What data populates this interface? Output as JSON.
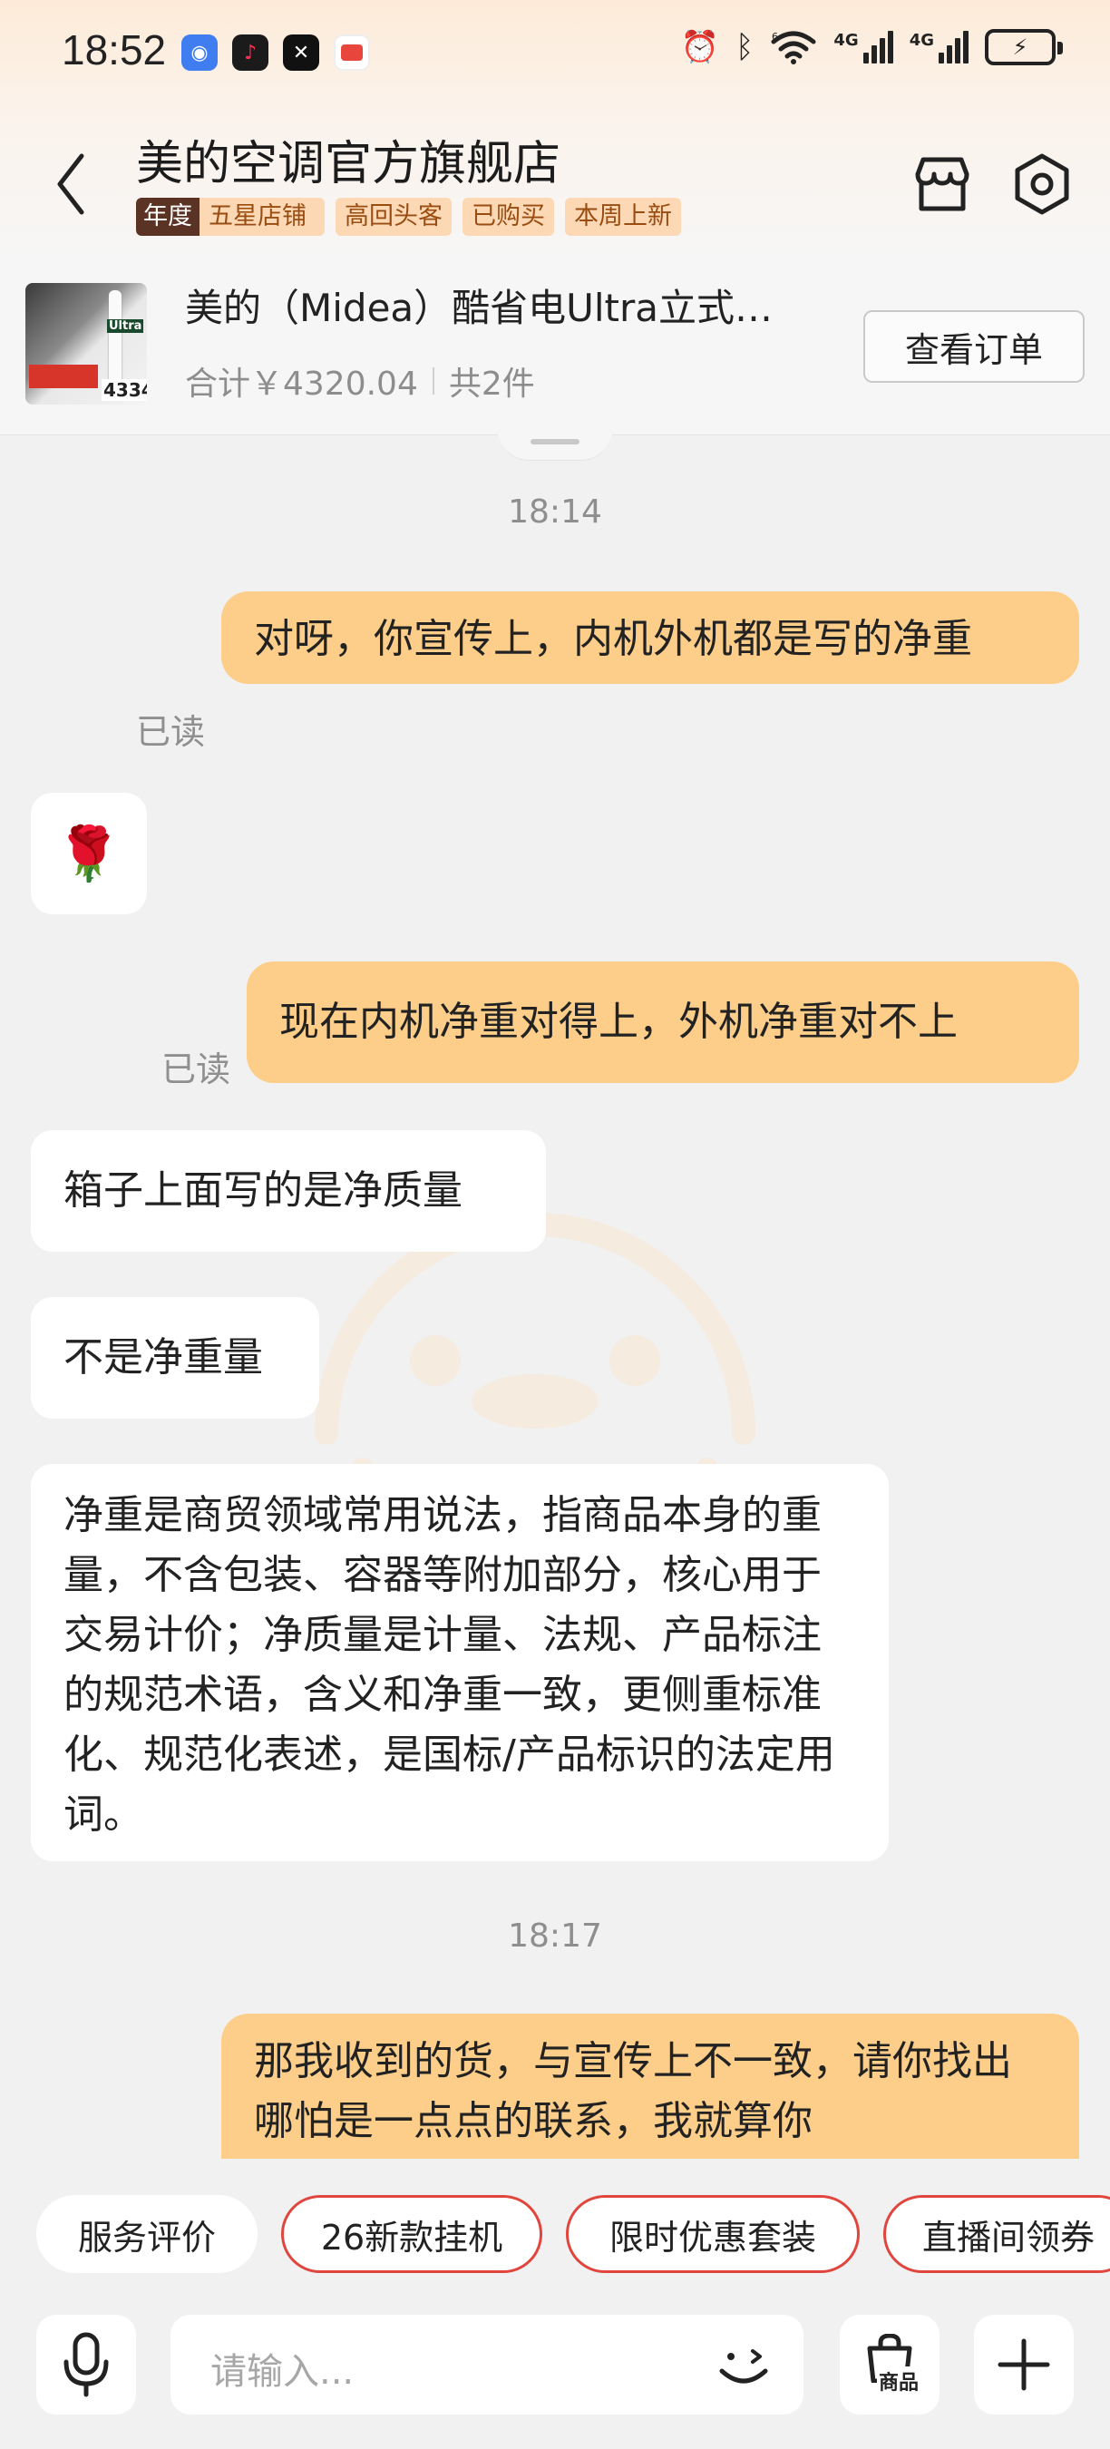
{
  "status_bar": {
    "time": "18:52",
    "apps": [
      {
        "icon": "blue-app-icon",
        "color": "#3f7df0",
        "glyph": "◉"
      },
      {
        "icon": "tiktok-icon",
        "color": "#1b1b1b",
        "glyph": "♪"
      },
      {
        "icon": "capcut-icon",
        "color": "#111111",
        "glyph": "✕"
      },
      {
        "icon": "red-app-icon",
        "color": "#e8453c",
        "glyph": "▬"
      }
    ],
    "network_label_1": "4G",
    "network_label_2": "4G",
    "wifi_label": "6"
  },
  "header": {
    "shop_name": "美的空调官方旗舰店",
    "tags": {
      "year_badge": "年度",
      "five_star": "五星店铺",
      "repeat": "高回头客",
      "bought": "已购买",
      "new_week": "本周上新"
    }
  },
  "order": {
    "product_title": "美的（Midea）酷省电Ultra立式…",
    "total": "合计￥4320.04",
    "count": "共2件",
    "view_order_label": "查看订单",
    "thumb_price": "4334",
    "thumb_badge": "Ultra"
  },
  "chat": {
    "time_1": "18:14",
    "msg_1": "对呀，你宣传上，内机外机都是写的净重",
    "read_1": "已读",
    "msg_2_emoji": "🌹",
    "msg_3": "现在内机净重对得上，外机净重对不上",
    "read_2": "已读",
    "msg_4": "箱子上面写的是净质量",
    "msg_5": "不是净重量",
    "msg_6": "净重是商贸领域常用说法，指商品本身的重量，不含包装、容器等附加部分，核心用于交易计价；净质量是计量、法规、产品标注的规范术语，含义和净重一致，更侧重标准化、规范化表述，是国标/产品标识的法定用词。",
    "time_2": "18:17",
    "msg_7": "那我收到的货，与宣传上不一致，请你找出哪怕是一点点的联系，我就算你"
  },
  "quick_chips": {
    "service_review": "服务评价",
    "new_hanging": "26新款挂机",
    "limited_bundle": "限时优惠套装",
    "live_coupon": "直播间领券"
  },
  "input": {
    "placeholder": "请输入...",
    "goods_label": "商品"
  },
  "colors": {
    "outgoing_bubble": "#fcce8a",
    "incoming_bubble": "#ffffff",
    "chip_border_red": "#e0463e",
    "tag_bg": "#fcd9b4",
    "tag_text": "#9a4d12"
  }
}
